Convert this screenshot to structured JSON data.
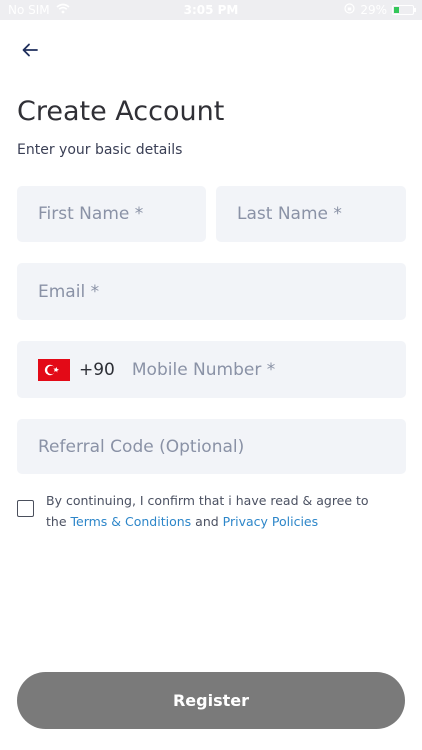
{
  "status_bar": {
    "carrier": "No SIM",
    "time": "3:05 PM",
    "battery_percent": "29%"
  },
  "title": "Create Account",
  "subtitle": "Enter your basic details",
  "form": {
    "first_name_placeholder": "First Name *",
    "last_name_placeholder": "Last Name *",
    "email_placeholder": "Email *",
    "country_code": "+90",
    "country_flag": "turkey-flag-icon",
    "mobile_placeholder": "Mobile Number *",
    "referral_placeholder": "Referral Code (Optional)"
  },
  "consent": {
    "checked": false,
    "text_part1": "By continuing, I confirm that i have read & agree to",
    "text_the": "the",
    "terms_link": "Terms & Conditions",
    "text_and": "and",
    "privacy_link": "Privacy Policies"
  },
  "register_label": "Register",
  "colors": {
    "field_bg": "#f2f4f8",
    "placeholder": "#8a92a6",
    "link": "#2d86c9",
    "register_bg": "#7a7a7a",
    "title": "#303036"
  }
}
